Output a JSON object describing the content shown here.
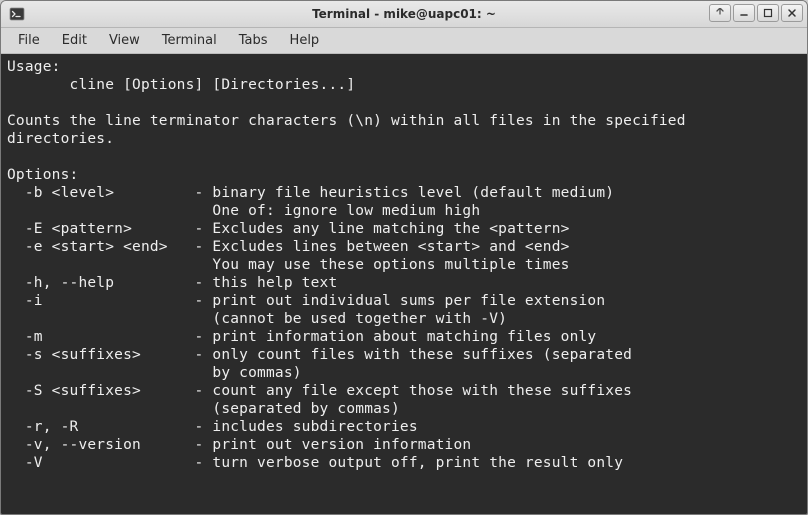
{
  "window": {
    "title": "Terminal - mike@uapc01: ~"
  },
  "menubar": {
    "items": [
      "File",
      "Edit",
      "View",
      "Terminal",
      "Tabs",
      "Help"
    ]
  },
  "terminal": {
    "lines": [
      "Usage:",
      "       cline [Options] [Directories...]",
      "",
      "Counts the line terminator characters (\\n) within all files in the specified",
      "directories.",
      "",
      "Options:",
      "  -b <level>         - binary file heuristics level (default medium)",
      "                       One of: ignore low medium high",
      "  -E <pattern>       - Excludes any line matching the <pattern>",
      "  -e <start> <end>   - Excludes lines between <start> and <end>",
      "                       You may use these options multiple times",
      "  -h, --help         - this help text",
      "  -i                 - print out individual sums per file extension",
      "                       (cannot be used together with -V)",
      "  -m                 - print information about matching files only",
      "  -s <suffixes>      - only count files with these suffixes (separated",
      "                       by commas)",
      "  -S <suffixes>      - count any file except those with these suffixes",
      "                       (separated by commas)",
      "  -r, -R             - includes subdirectories",
      "  -v, --version      - print out version information",
      "  -V                 - turn verbose output off, print the result only"
    ]
  }
}
